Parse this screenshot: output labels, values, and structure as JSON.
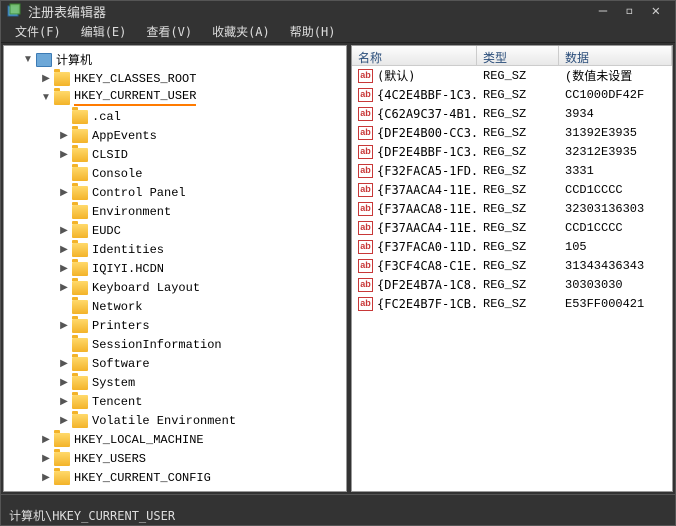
{
  "window": {
    "title": "注册表编辑器"
  },
  "menu": {
    "file": "文件(F)",
    "edit": "编辑(E)",
    "view": "查看(V)",
    "favorites": "收藏夹(A)",
    "help": "帮助(H)"
  },
  "tree": {
    "root": "计算机",
    "hives": [
      {
        "label": "HKEY_CLASSES_ROOT",
        "expanded": false,
        "selected": false
      },
      {
        "label": "HKEY_CURRENT_USER",
        "expanded": true,
        "selected": true
      },
      {
        "label": "HKEY_LOCAL_MACHINE",
        "expanded": false,
        "selected": false
      },
      {
        "label": "HKEY_USERS",
        "expanded": false,
        "selected": false
      },
      {
        "label": "HKEY_CURRENT_CONFIG",
        "expanded": false,
        "selected": false
      }
    ],
    "current_user_children": [
      {
        "label": ".cal",
        "has_children": false
      },
      {
        "label": "AppEvents",
        "has_children": true
      },
      {
        "label": "CLSID",
        "has_children": true
      },
      {
        "label": "Console",
        "has_children": false
      },
      {
        "label": "Control Panel",
        "has_children": true
      },
      {
        "label": "Environment",
        "has_children": false
      },
      {
        "label": "EUDC",
        "has_children": true
      },
      {
        "label": "Identities",
        "has_children": true
      },
      {
        "label": "IQIYI.HCDN",
        "has_children": true
      },
      {
        "label": "Keyboard Layout",
        "has_children": true
      },
      {
        "label": "Network",
        "has_children": false
      },
      {
        "label": "Printers",
        "has_children": true
      },
      {
        "label": "SessionInformation",
        "has_children": false
      },
      {
        "label": "Software",
        "has_children": true
      },
      {
        "label": "System",
        "has_children": true
      },
      {
        "label": "Tencent",
        "has_children": true
      },
      {
        "label": "Volatile Environment",
        "has_children": true
      }
    ]
  },
  "list": {
    "headers": {
      "name": "名称",
      "type": "类型",
      "data": "数据"
    },
    "rows": [
      {
        "name": "(默认)",
        "type": "REG_SZ",
        "data": "(数值未设置"
      },
      {
        "name": "{4C2E4BBF-1C3...",
        "type": "REG_SZ",
        "data": "CC1000DF42F"
      },
      {
        "name": "{C62A9C37-4B1...",
        "type": "REG_SZ",
        "data": "3934"
      },
      {
        "name": "{DF2E4B00-CC3...",
        "type": "REG_SZ",
        "data": "31392E3935"
      },
      {
        "name": "{DF2E4BBF-1C3...",
        "type": "REG_SZ",
        "data": "32312E3935"
      },
      {
        "name": "{F32FACA5-1FD...",
        "type": "REG_SZ",
        "data": "3331"
      },
      {
        "name": "{F37AACA4-11E...",
        "type": "REG_SZ",
        "data": "CCD1CCCC"
      },
      {
        "name": "{F37AACA8-11E...",
        "type": "REG_SZ",
        "data": "32303136303"
      },
      {
        "name": "{F37AACA4-11E...",
        "type": "REG_SZ",
        "data": "CCD1CCCC"
      },
      {
        "name": "{F37FACA0-11D...",
        "type": "REG_SZ",
        "data": "105"
      },
      {
        "name": "{F3CF4CA8-C1E...",
        "type": "REG_SZ",
        "data": "31343436343"
      },
      {
        "name": "{DF2E4B7A-1C8...",
        "type": "REG_SZ",
        "data": "30303030"
      },
      {
        "name": "{FC2E4B7F-1CB...",
        "type": "REG_SZ",
        "data": "E53FF000421"
      }
    ]
  },
  "statusbar": {
    "path": "计算机\\HKEY_CURRENT_USER"
  }
}
